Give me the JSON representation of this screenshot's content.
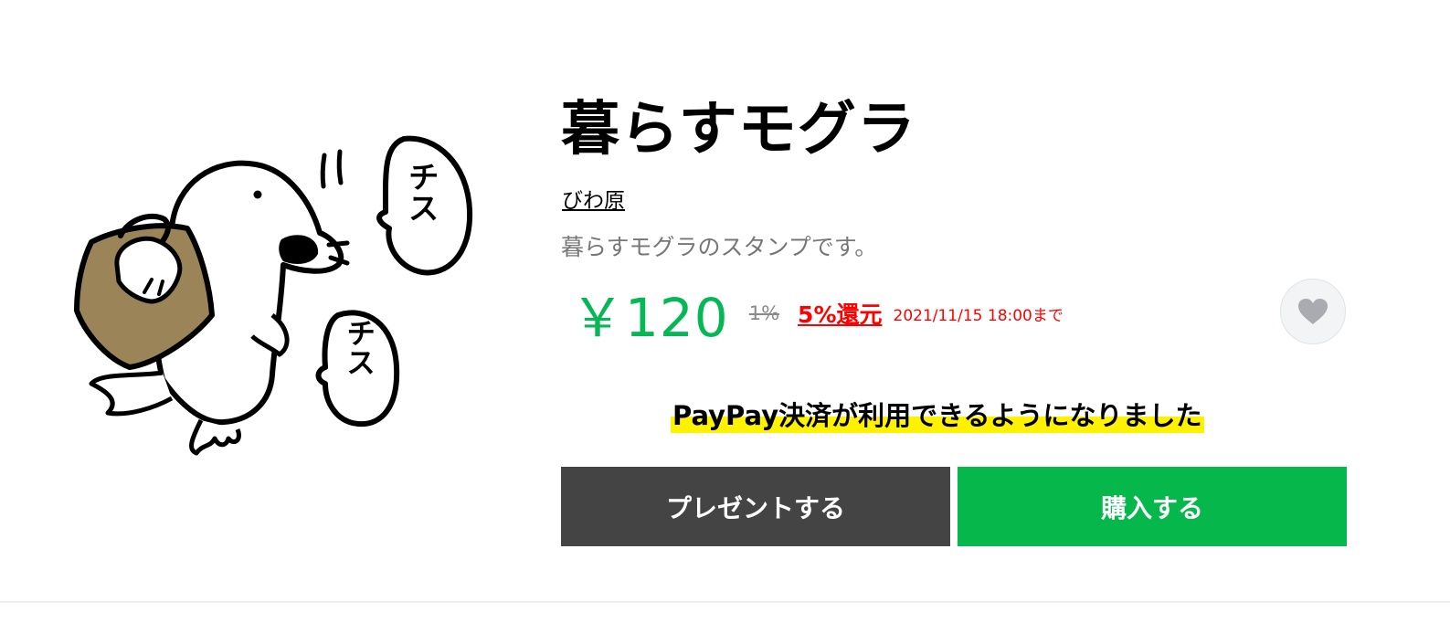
{
  "product": {
    "title": "暮らすモグラ",
    "author": "びわ原",
    "description": "暮らすモグラのスタンプです。",
    "sticker_bubble_text": "チス"
  },
  "pricing": {
    "price": "￥120",
    "old_rate": "1%",
    "new_rate": "5%還元",
    "deadline": "2021/11/15 18:00まで"
  },
  "banner": {
    "text": "PayPay決済が利用できるようになりました"
  },
  "actions": {
    "present_label": "プレゼントする",
    "buy_label": "購入する"
  },
  "colors": {
    "price_green": "#06b755",
    "buy_green": "#06b74c",
    "present_gray": "#444444",
    "promo_red": "#ff0000",
    "highlight_yellow": "#fff200"
  },
  "icons": {
    "favorite": "heart-icon"
  }
}
